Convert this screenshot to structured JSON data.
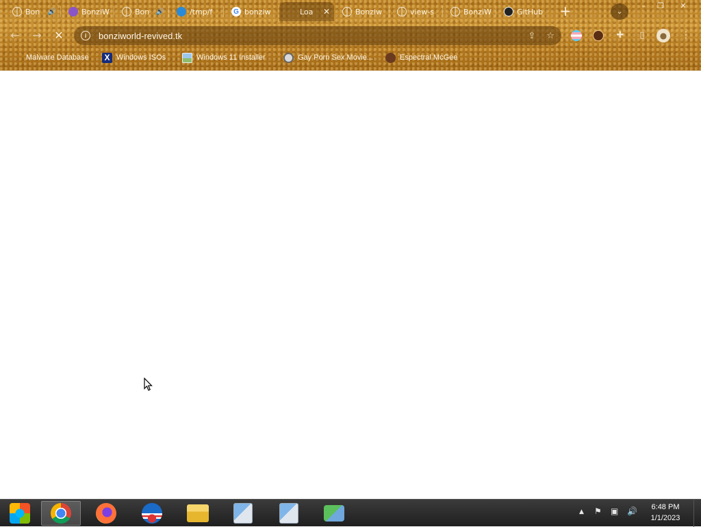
{
  "tabs": [
    {
      "title": "Bon",
      "favicon": "globe-icon",
      "audio": true
    },
    {
      "title": "BonziW",
      "favicon": "bonzi-icon",
      "audio": false
    },
    {
      "title": "Bon",
      "favicon": "globe-icon",
      "audio": true
    },
    {
      "title": "/tmp/f",
      "favicon": "edge-icon",
      "audio": false
    },
    {
      "title": "bonziw",
      "favicon": "google-icon",
      "audio": false
    },
    {
      "title": "Loa",
      "favicon": "none",
      "audio": false,
      "active": true
    },
    {
      "title": "Bonziw",
      "favicon": "globe-icon",
      "audio": false
    },
    {
      "title": "view-s",
      "favicon": "globe-icon",
      "audio": false
    },
    {
      "title": "BonziW",
      "favicon": "globe-icon",
      "audio": false
    },
    {
      "title": "GitHub",
      "favicon": "github-icon",
      "audio": false
    }
  ],
  "toolbar": {
    "url": "bonziworld-revived.tk",
    "back_glyph": "←",
    "forward_glyph": "→",
    "stop_glyph": "✕",
    "new_tab_glyph": "+",
    "tab_search_glyph": "⌄",
    "window_buttons": [
      "–",
      "❐",
      "✕"
    ]
  },
  "bookmarks": [
    {
      "label": "Malware Database",
      "icon": "malware-icon"
    },
    {
      "label": "Windows ISOs",
      "icon": "x-icon"
    },
    {
      "label": "Windows 11 Installer",
      "icon": "image-icon"
    },
    {
      "label": "Gay Porn Sex Movie...",
      "icon": "disc-icon"
    },
    {
      "label": "Espectral McGee",
      "icon": "face-icon"
    }
  ],
  "taskbar": {
    "apps": [
      "start-orb",
      "chrome",
      "firefox",
      "obama-logo",
      "file-explorer",
      "setup-1",
      "setup-2",
      "network-app"
    ],
    "active_app": "chrome",
    "clock_time": "6:48 PM",
    "clock_date": "1/1/2023"
  },
  "colors": {
    "chrome_bg": "#b77d22",
    "taskbar_bg": "#2a2a2a",
    "page_bg": "#ffffff"
  }
}
